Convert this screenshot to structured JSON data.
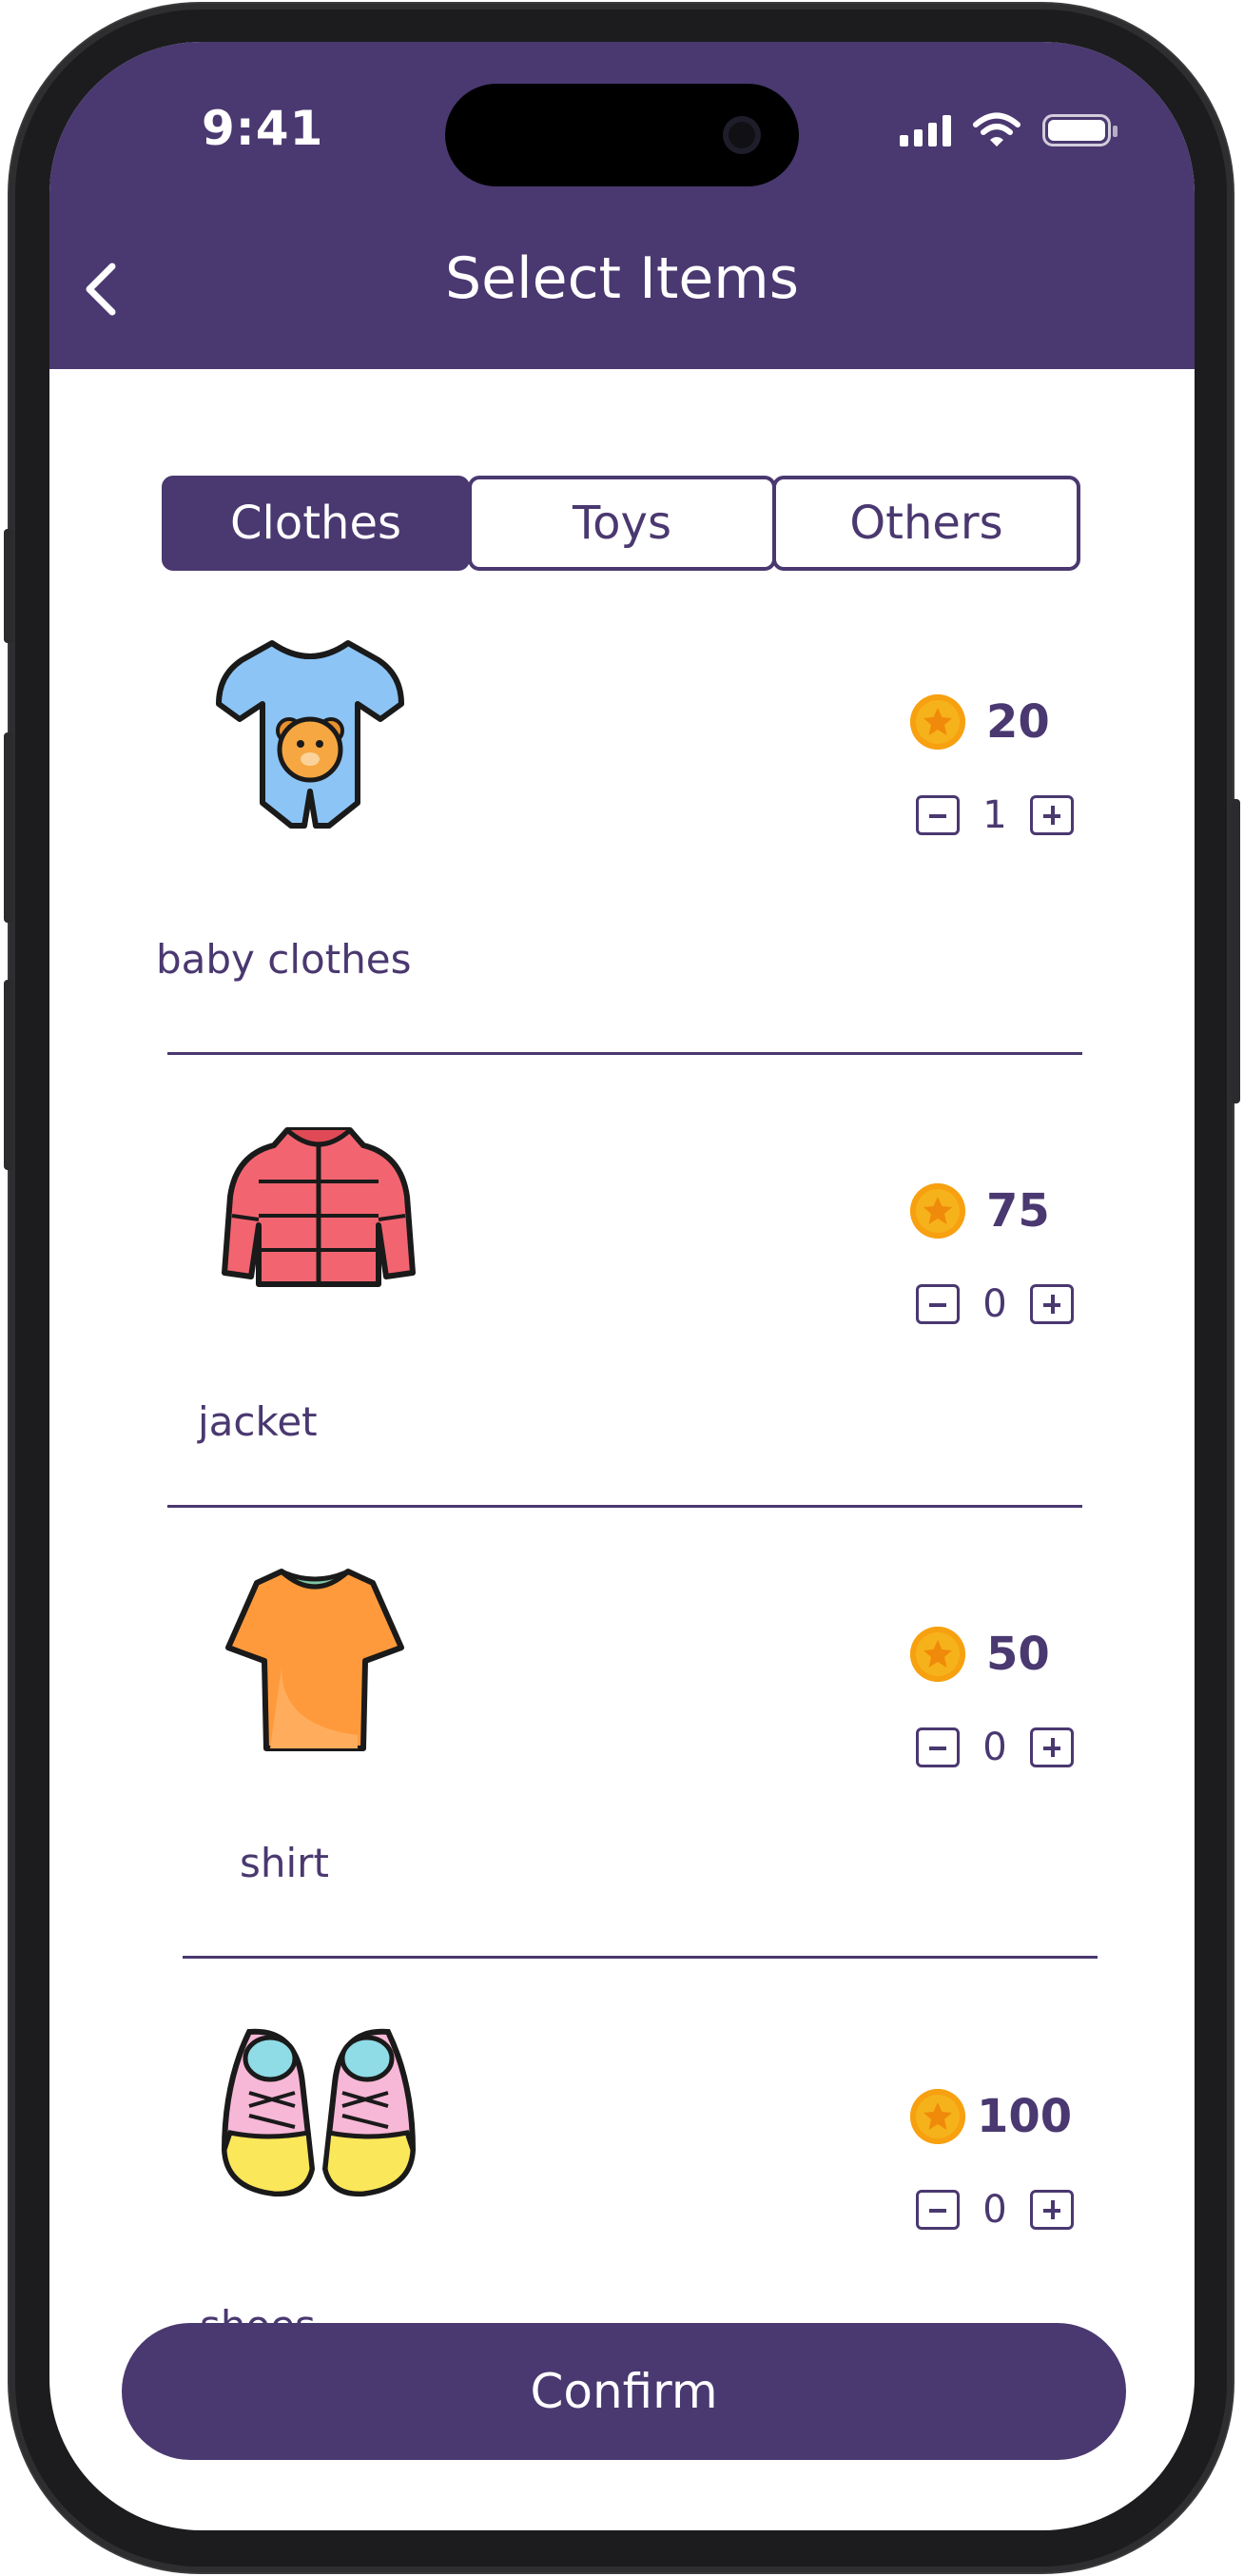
{
  "status_bar": {
    "time": "9:41"
  },
  "header": {
    "title": "Select Items"
  },
  "tabs": [
    {
      "label": "Clothes",
      "active": true
    },
    {
      "label": "Toys",
      "active": false
    },
    {
      "label": "Others",
      "active": false
    }
  ],
  "items": [
    {
      "name": "baby clothes",
      "icon": "baby-romper-icon",
      "price": "20",
      "quantity": "1"
    },
    {
      "name": "jacket",
      "icon": "jacket-icon",
      "price": "75",
      "quantity": "0"
    },
    {
      "name": "shirt",
      "icon": "shirt-icon",
      "price": "50",
      "quantity": "0"
    },
    {
      "name": "shoes",
      "icon": "shoes-icon",
      "price": "100",
      "quantity": "0"
    }
  ],
  "confirm_label": "Confirm",
  "colors": {
    "primary": "#4a3870",
    "coin": "#f6b21a",
    "background": "#ffffff"
  }
}
